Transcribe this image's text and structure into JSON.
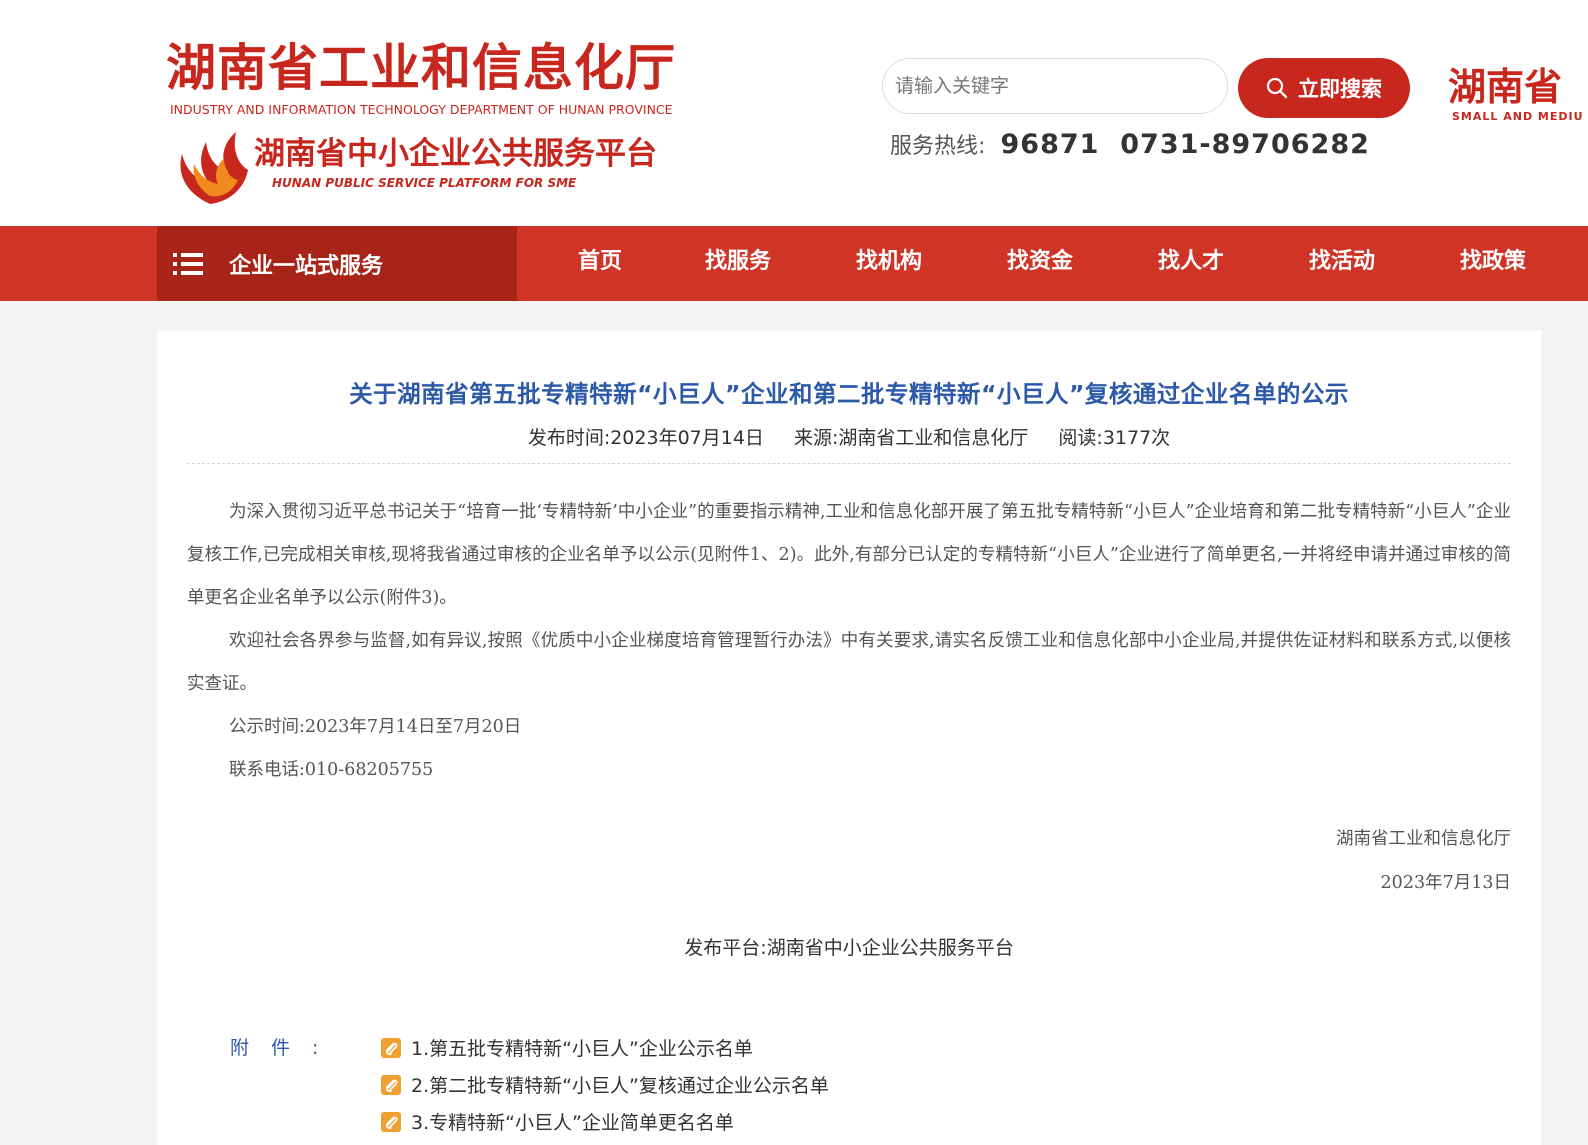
{
  "header": {
    "org_title": "湖南省工业和信息化厅",
    "org_title_en": "INDUSTRY AND INFORMATION TECHNOLOGY DEPARTMENT OF HUNAN PROVINCE",
    "platform_title": "湖南省中小企业公共服务平台",
    "platform_title_en": "HUNAN PUBLIC SERVICE PLATFORM FOR SME",
    "search": {
      "placeholder": "请输入关键字",
      "button_label": "立即搜索"
    },
    "hotline": {
      "label": "服务热线:",
      "numbers": "96871  0731-89706282"
    },
    "right_logo": {
      "text": "湖南省",
      "text_en": "SMALL AND MEDIU"
    }
  },
  "nav": {
    "service_label": "企业一站式服务",
    "items": [
      {
        "label": "首页"
      },
      {
        "label": "找服务"
      },
      {
        "label": "找机构"
      },
      {
        "label": "找资金"
      },
      {
        "label": "找人才"
      },
      {
        "label": "找活动"
      },
      {
        "label": "找政策"
      }
    ]
  },
  "article": {
    "title": "关于湖南省第五批专精特新“小巨人”企业和第二批专精特新“小巨人”复核通过企业名单的公示",
    "publish_time": "发布时间:2023年07月14日",
    "source": "来源:湖南省工业和信息化厅",
    "reads": "阅读:3177次",
    "paragraphs": [
      "为深入贯彻习近平总书记关于“培育一批‘专精特新’中小企业”的重要指示精神,工业和信息化部开展了第五批专精特新“小巨人”企业培育和第二批专精特新“小巨人”企业复核工作,已完成相关审核,现将我省通过审核的企业名单予以公示(见附件1、2)。此外,有部分已认定的专精特新“小巨人”企业进行了简单更名,一并将经申请并通过审核的简单更名企业名单予以公示(附件3)。",
      "欢迎社会各界参与监督,如有异议,按照《优质中小企业梯度培育管理暂行办法》中有关要求,请实名反馈工业和信息化部中小企业局,并提供佐证材料和联系方式,以便核实查证。",
      "公示时间:2023年7月14日至7月20日",
      "联系电话:010-68205755"
    ],
    "signature_org": "湖南省工业和信息化厅",
    "signature_date": "2023年7月13日",
    "publisher": "发布平台:湖南省中小企业公共服务平台",
    "attachments_label": "附件:",
    "attachments": [
      {
        "label": "1.第五批专精特新“小巨人”企业公示名单"
      },
      {
        "label": "2.第二批专精特新“小巨人”复核通过企业公示名单"
      },
      {
        "label": "3.专精特新“小巨人”企业简单更名名单"
      }
    ]
  },
  "colors": {
    "brand_red": "#c8271e",
    "nav_red": "#d03426",
    "nav_dark_red": "#a82318",
    "title_blue": "#2d5aa8",
    "attachment_icon": "#f0a030"
  }
}
